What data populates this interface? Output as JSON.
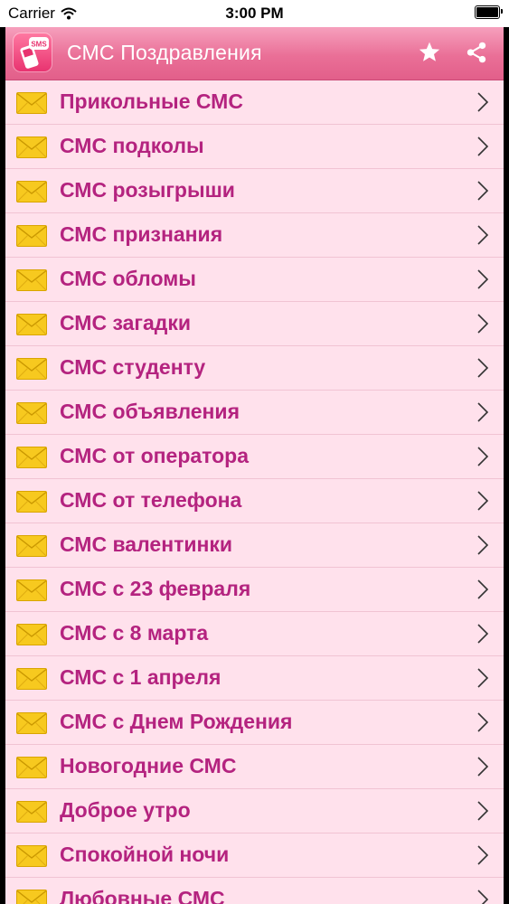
{
  "status_bar": {
    "carrier": "Carrier",
    "time": "3:00 PM",
    "wifi_icon": "wifi-icon",
    "battery_icon": "battery-icon"
  },
  "app_bar": {
    "title": "СМС Поздравления",
    "icon_text": "SMS",
    "actions": [
      "star-icon",
      "share-icon"
    ]
  },
  "colors": {
    "header": "#e8729a",
    "list_background": "#ffe1ec",
    "item_text": "#b4237f",
    "envelope": "#f7c91f"
  },
  "list": {
    "item_icon": "envelope-icon",
    "items": [
      {
        "label": "Прикольные СМС"
      },
      {
        "label": "СМС подколы"
      },
      {
        "label": "СМС розыгрыши"
      },
      {
        "label": "СМС признания"
      },
      {
        "label": "СМС обломы"
      },
      {
        "label": "СМС загадки"
      },
      {
        "label": "СМС студенту"
      },
      {
        "label": "СМС объявления"
      },
      {
        "label": "СМС от оператора"
      },
      {
        "label": "СМС от телефона"
      },
      {
        "label": "СМС валентинки"
      },
      {
        "label": "СМС с 23 февраля"
      },
      {
        "label": "СМС с 8 марта"
      },
      {
        "label": "СМС с 1 апреля"
      },
      {
        "label": "СМС с Днем Рождения"
      },
      {
        "label": "Новогодние СМС"
      },
      {
        "label": "Доброе утро"
      },
      {
        "label": "Спокойной ночи"
      },
      {
        "label": "Любовные СМС"
      }
    ]
  }
}
